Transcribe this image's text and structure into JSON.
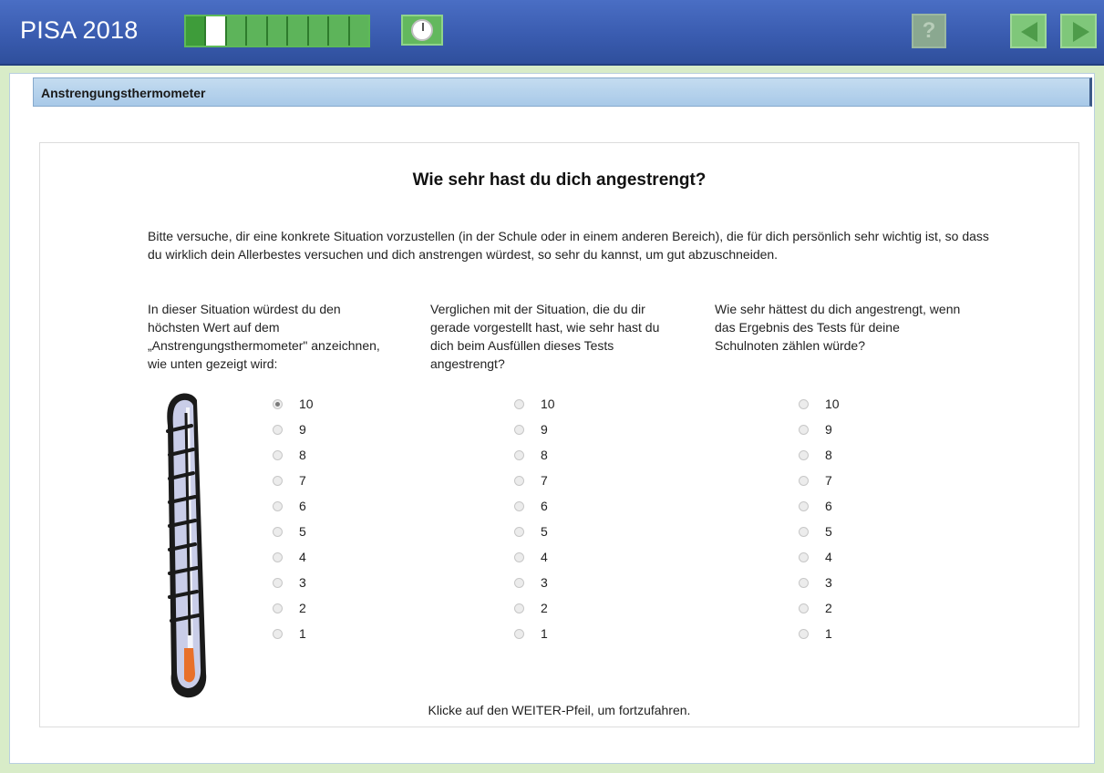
{
  "app": {
    "title": "PISA 2018",
    "help_label": "?"
  },
  "progress": {
    "current_step": 2,
    "total_steps": 9
  },
  "section": {
    "title": "Anstrengungsthermometer"
  },
  "question": {
    "title": "Wie sehr hast du dich angestrengt?",
    "intro": "Bitte versuche, dir eine konkrete Situation vorzustellen (in der Schule oder in einem anderen Bereich), die für dich persönlich sehr wichtig ist, so dass du wirklich dein Allerbestes versuchen und dich anstrengen würdest, so sehr du kannst, um gut abzuschneiden.",
    "columns": [
      {
        "text": "In dieser Situation würdest du den höchsten Wert auf dem „Anstrengungsthermometer\" anzeichnen, wie unten gezeigt wird:",
        "selected": "10"
      },
      {
        "text": "Verglichen mit der Situation, die du dir gerade vorgestellt hast, wie sehr hast du dich beim Ausfüllen dieses Tests angestrengt?",
        "selected": null
      },
      {
        "text": "Wie sehr hättest du dich angestrengt, wenn das Ergebnis des Tests für deine Schulnoten zählen würde?",
        "selected": null
      }
    ],
    "options": [
      "10",
      "9",
      "8",
      "7",
      "6",
      "5",
      "4",
      "3",
      "2",
      "1"
    ],
    "footer": "Klicke auf den WEITER-Pfeil, um fortzufahren."
  },
  "colors": {
    "topbar": "#3a5cb0",
    "accent_green": "#5db45a",
    "header_blue": "#a8c9e8",
    "thermometer_fill": "#e8702a"
  }
}
